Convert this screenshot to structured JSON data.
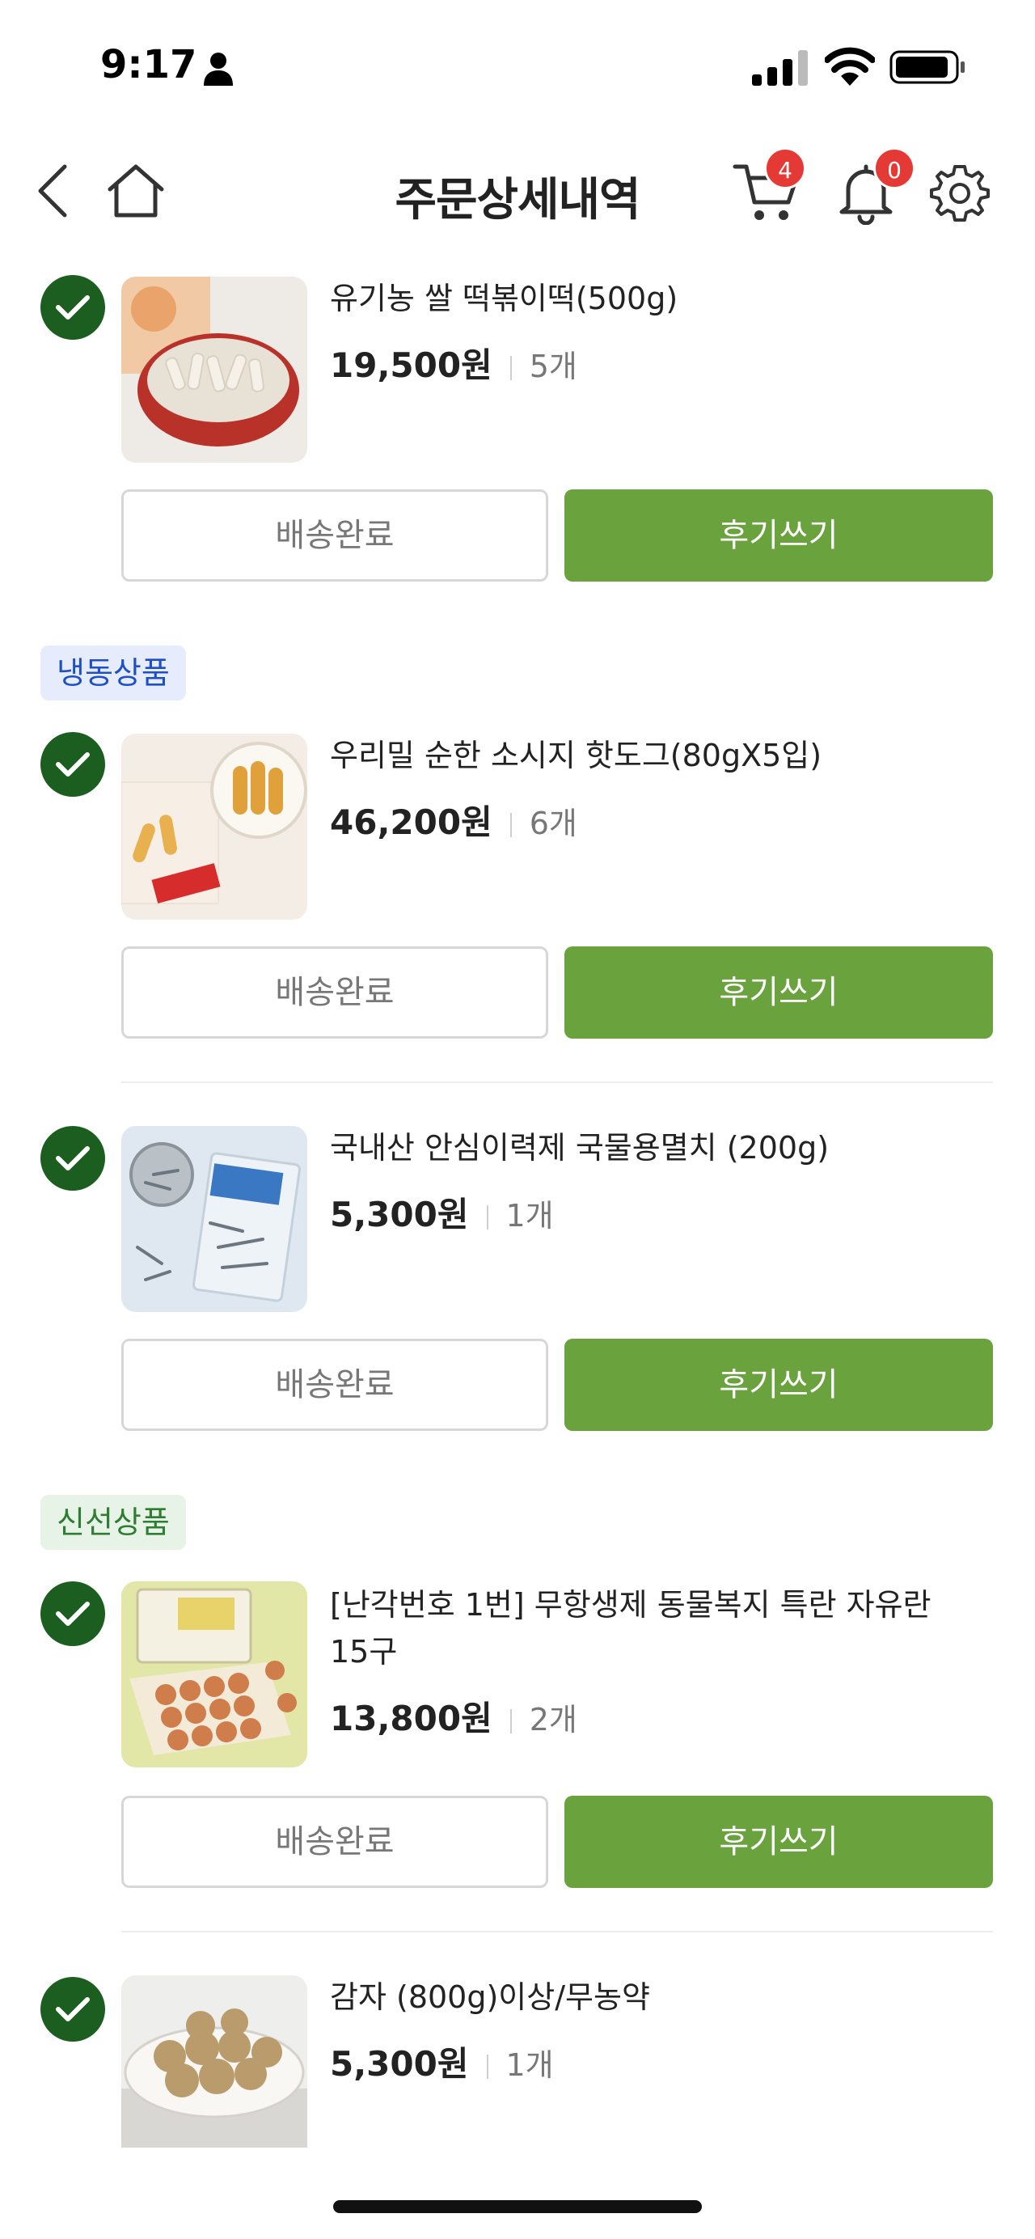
{
  "status_bar": {
    "time": "9:17",
    "icons": [
      "person-icon",
      "signal-icon",
      "wifi-icon",
      "battery-icon"
    ]
  },
  "header": {
    "title": "주문상세내역",
    "cart_count": "4",
    "notification_count": "0",
    "icons": [
      "back-icon",
      "home-icon",
      "cart-icon",
      "bell-icon",
      "gear-icon"
    ]
  },
  "colors": {
    "accent_green": "#6aa23e",
    "check_green": "#1b5e20",
    "badge_red": "#e53935",
    "frozen_tag_text": "#1f4fc6",
    "fresh_tag_text": "#2e7d32"
  },
  "sections": {
    "frozen": "냉동상품",
    "fresh": "신선상품"
  },
  "items": [
    {
      "name": "유기농 쌀 떡볶이떡(500g)",
      "price": "19,500원",
      "qty": "5개",
      "status": "배송완료",
      "review": "후기쓰기"
    },
    {
      "name": "우리밀 순한 소시지 핫도그(80gX5입)",
      "price": "46,200원",
      "qty": "6개",
      "status": "배송완료",
      "review": "후기쓰기"
    },
    {
      "name": "국내산 안심이력제 국물용멸치 (200g)",
      "price": "5,300원",
      "qty": "1개",
      "status": "배송완료",
      "review": "후기쓰기"
    },
    {
      "name": "[난각번호 1번] 무항생제 동물복지 특란 자유란 15구",
      "price": "13,800원",
      "qty": "2개",
      "status": "배송완료",
      "review": "후기쓰기"
    },
    {
      "name": "감자 (800g)이상/무농약",
      "price": "5,300원",
      "qty": "1개"
    }
  ]
}
